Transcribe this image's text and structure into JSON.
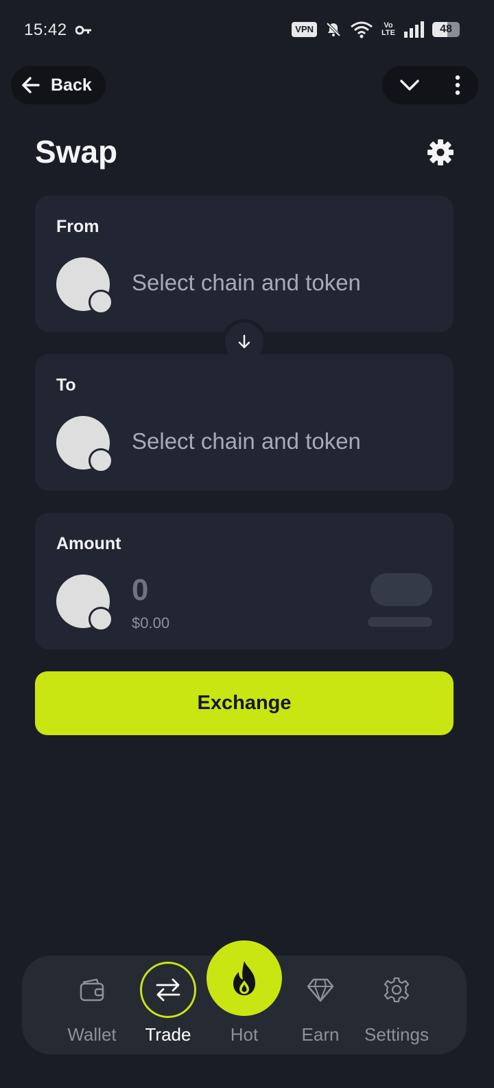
{
  "status_bar": {
    "time": "15:42",
    "vpn": "VPN",
    "volte_top": "Vo",
    "volte_bottom": "LTE",
    "battery": "48"
  },
  "header": {
    "back_label": "Back",
    "title": "Swap"
  },
  "from_card": {
    "label": "From",
    "placeholder": "Select chain and token"
  },
  "to_card": {
    "label": "To",
    "placeholder": "Select chain and token"
  },
  "amount_card": {
    "label": "Amount",
    "value": "0",
    "usd_value": "$0.00"
  },
  "exchange_button": "Exchange",
  "bottom_nav": {
    "items": [
      {
        "label": "Wallet",
        "icon": "wallet-icon"
      },
      {
        "label": "Trade",
        "icon": "swap-arrows-icon",
        "active": true
      },
      {
        "label": "Hot",
        "icon": "flame-icon"
      },
      {
        "label": "Earn",
        "icon": "diamond-icon"
      },
      {
        "label": "Settings",
        "icon": "gear-icon"
      }
    ]
  },
  "colors": {
    "background": "#1a1d25",
    "card": "#222632",
    "accent": "#c9e512",
    "muted_text": "#a8aab6"
  }
}
